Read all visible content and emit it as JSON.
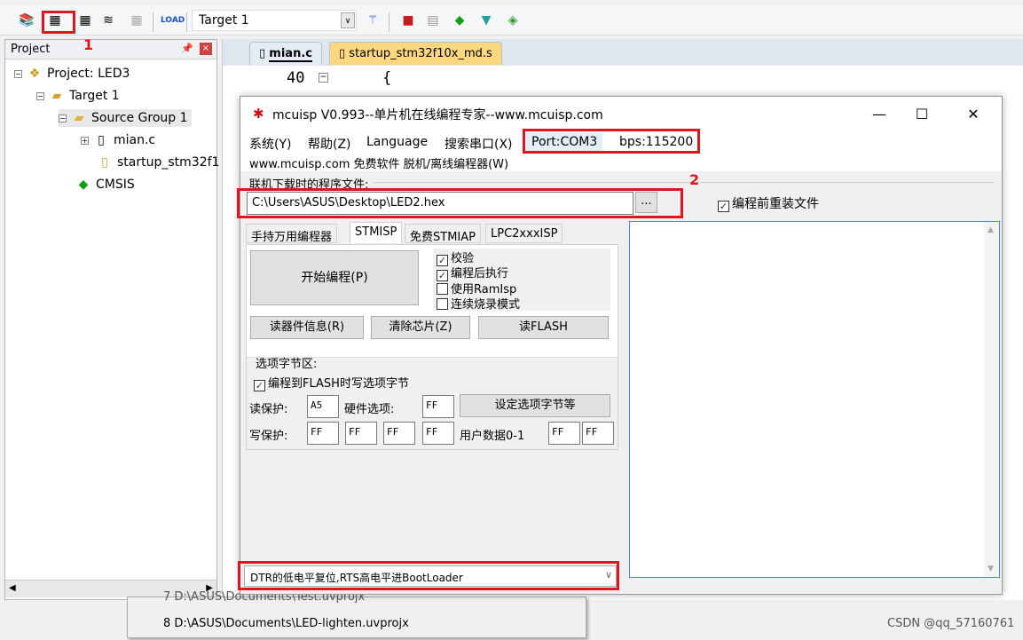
{
  "toolbar": {
    "target_select": "Target 1",
    "icons": [
      "translate-icon",
      "build-icon",
      "rebuild-icon",
      "batch-build-icon",
      "stop-build-icon",
      "download-load-icon",
      "options-wand-icon",
      "manage-components-icon",
      "pack-installer-icon",
      "select-packs-icon",
      "funnel-icon",
      "manage-runtime-icon"
    ]
  },
  "annotations": {
    "label_1": "1",
    "label_2": "2",
    "highlight_color": "#e0141e"
  },
  "project": {
    "title": "Project",
    "tree": [
      {
        "label": "Project: LED3",
        "icon": "project-icon"
      },
      {
        "label": "Target 1",
        "icon": "target-folder-icon"
      },
      {
        "label": "Source Group 1",
        "icon": "folder-icon"
      },
      {
        "label": "mian.c",
        "icon": "file-icon"
      },
      {
        "label": "startup_stm32f1",
        "icon": "asm-file-icon"
      },
      {
        "label": "CMSIS",
        "icon": "cmsis-diamond-icon"
      }
    ]
  },
  "editor": {
    "tabs": [
      {
        "label": "mian.c",
        "active": true
      },
      {
        "label": "startup_stm32f10x_md.s",
        "active": false
      }
    ],
    "line_number": "40",
    "code": "{"
  },
  "recent": {
    "items": [
      "7 D:\\ASUS\\Documents\\Test.uvprojx",
      "8 D:\\ASUS\\Documents\\LED-lighten.uvprojx"
    ]
  },
  "dialog": {
    "title": "mcuisp V0.993--单片机在线编程专家--www.mcuisp.com",
    "menu": [
      "系统(Y)",
      "帮助(Z)",
      "Language",
      "搜索串口(X)"
    ],
    "port": "Port:COM3",
    "bps": "bps:115200",
    "menu2": "www.mcuisp.com 免费软件 脱机/离线编程器(W)",
    "file_label": "联机下载时的程序文件:",
    "file_path": "C:\\Users\\ASUS\\Desktop\\LED2.hex",
    "browse": "...",
    "reload_label": "编程前重装文件",
    "reload_checked": true,
    "tabs": [
      "手持万用编程器",
      "STMISP",
      "免费STMIAP",
      "LPC2xxxISP"
    ],
    "active_tab": "STMISP",
    "start_button": "开始编程(P)",
    "options": [
      {
        "label": "校验",
        "checked": true
      },
      {
        "label": "编程后执行",
        "checked": true
      },
      {
        "label": "使用RamIsp",
        "checked": false
      },
      {
        "label": "连续烧录模式",
        "checked": false
      }
    ],
    "read_info": "读器件信息(R)",
    "erase": "清除芯片(Z)",
    "read_flash": "读FLASH",
    "option_group": "选项字节区:",
    "write_option_label": "编程到FLASH时写选项字节",
    "write_option_checked": true,
    "read_protect_label": "读保护:",
    "read_protect": "A5",
    "hw_option_label": "硬件选项:",
    "hw_option": "FF",
    "set_option_button": "设定选项字节等",
    "write_protect_label": "写保护:",
    "write_protect": [
      "FF",
      "FF",
      "FF",
      "FF"
    ],
    "user_data_label": "用户数据0-1",
    "user_data": [
      "FF",
      "FF"
    ],
    "reset_mode": "DTR的低电平复位,RTS高电平进BootLoader"
  },
  "watermark": "CSDN @qq_57160761"
}
